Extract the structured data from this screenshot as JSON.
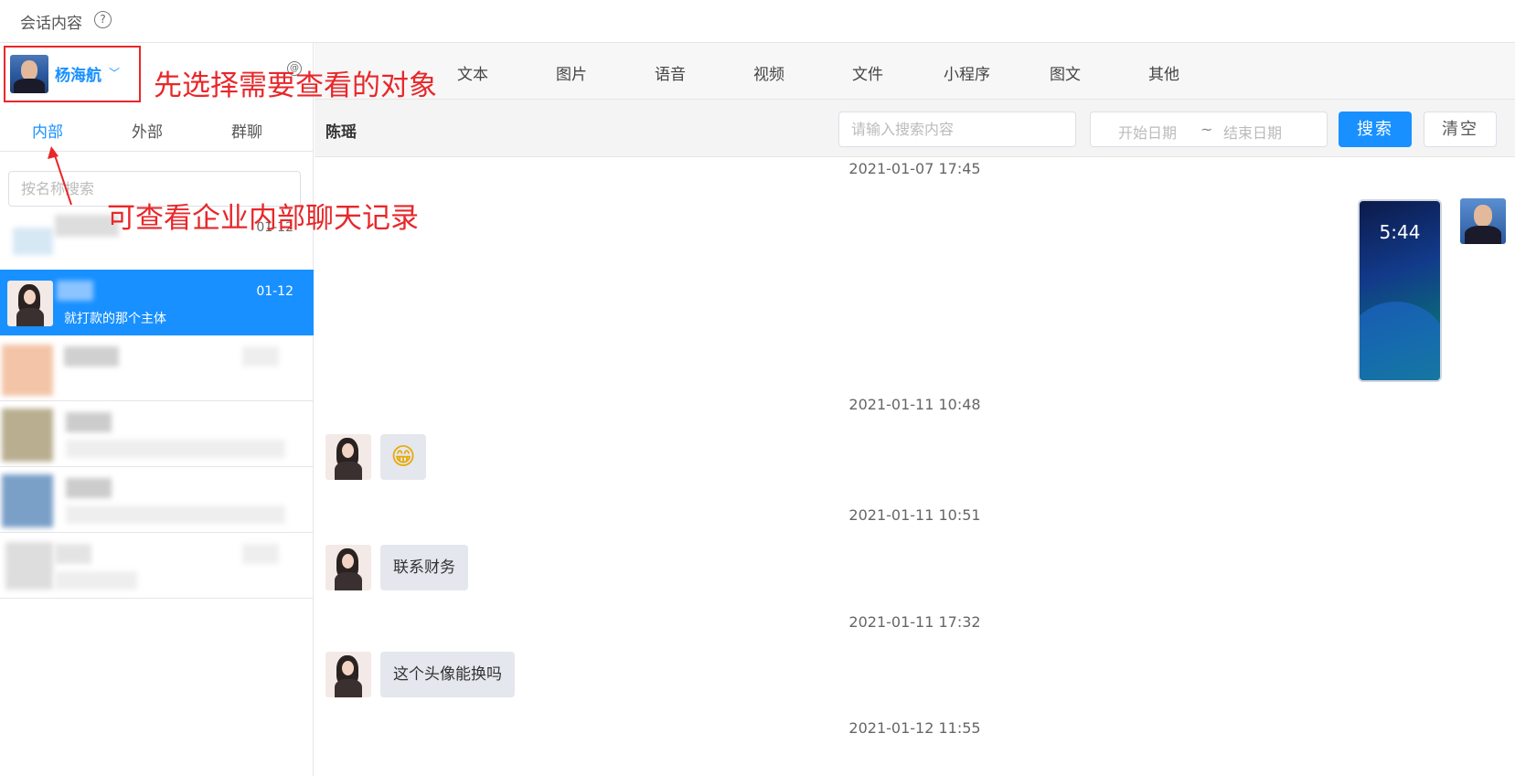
{
  "page": {
    "title": "会话内容",
    "help_glyph": "?"
  },
  "user": {
    "name": "杨海航",
    "chevron": "﹀"
  },
  "left_tabs": [
    "内部",
    "外部",
    "群聊"
  ],
  "name_search": {
    "placeholder": "按名称搜索"
  },
  "conversations": [
    {
      "date": "01-12",
      "message": ""
    },
    {
      "date": "01-12",
      "message": "就打款的那个主体"
    }
  ],
  "type_tabs": [
    "文本",
    "图片",
    "语音",
    "视频",
    "文件",
    "小程序",
    "图文",
    "其他"
  ],
  "type_tab_circle": "@",
  "contact": {
    "name": "陈瑶"
  },
  "search": {
    "keyword_placeholder": "请输入搜索内容",
    "start_placeholder": "开始日期",
    "separator": "~",
    "end_placeholder": "结束日期",
    "search_label": "搜索",
    "clear_label": "清空"
  },
  "messages": [
    {
      "time": "2021-01-07 17:45",
      "phone_clock": "5:44"
    },
    {
      "time": "2021-01-11 10:48",
      "emoji": "😁"
    },
    {
      "time": "2021-01-11 10:51",
      "text": "联系财务"
    },
    {
      "time": "2021-01-11 17:32",
      "text": "这个头像能换吗"
    },
    {
      "time": "2021-01-12 11:55"
    }
  ],
  "annotations": {
    "select_target": "先选择需要查看的对象",
    "internal_records": "可查看企业内部聊天记录"
  },
  "colors": {
    "primary": "#1890ff",
    "annotation": "#e8272a"
  }
}
